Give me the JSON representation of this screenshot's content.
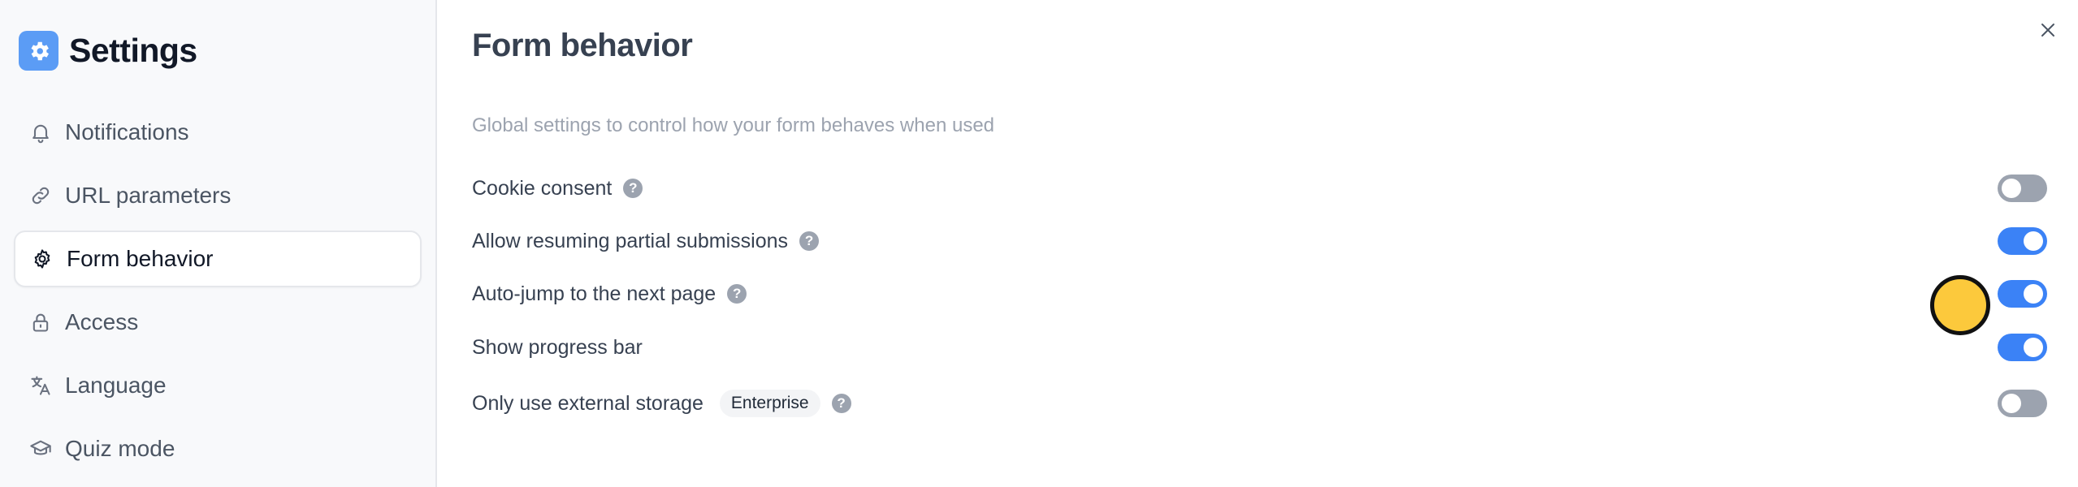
{
  "sidebar": {
    "title": "Settings",
    "brand_icon": "gear-icon",
    "items": [
      {
        "label": "Notifications",
        "icon": "bell-icon",
        "active": false
      },
      {
        "label": "URL parameters",
        "icon": "link-icon",
        "active": false
      },
      {
        "label": "Form behavior",
        "icon": "gear-icon",
        "active": true
      },
      {
        "label": "Access",
        "icon": "lock-icon",
        "active": false
      },
      {
        "label": "Language",
        "icon": "translate-icon",
        "active": false
      },
      {
        "label": "Quiz mode",
        "icon": "graduation-cap-icon",
        "active": false
      }
    ]
  },
  "main": {
    "title": "Form behavior",
    "subtitle": "Global settings to control how your form behaves when used",
    "close_icon": "close-icon",
    "settings": [
      {
        "label": "Cookie consent",
        "help": true,
        "enabled": false
      },
      {
        "label": "Allow resuming partial submissions",
        "help": true,
        "enabled": true
      },
      {
        "label": "Auto-jump to the next page",
        "help": true,
        "enabled": true
      },
      {
        "label": "Show progress bar",
        "help": false,
        "enabled": true
      },
      {
        "label": "Only use external storage",
        "badge": "Enterprise",
        "help": true,
        "enabled": false
      }
    ]
  },
  "colors": {
    "accent": "#3b82f6",
    "toggle_off": "#9ca3af",
    "brand_icon_bg": "#5b9cf5",
    "cursor": "#fcc93c"
  }
}
